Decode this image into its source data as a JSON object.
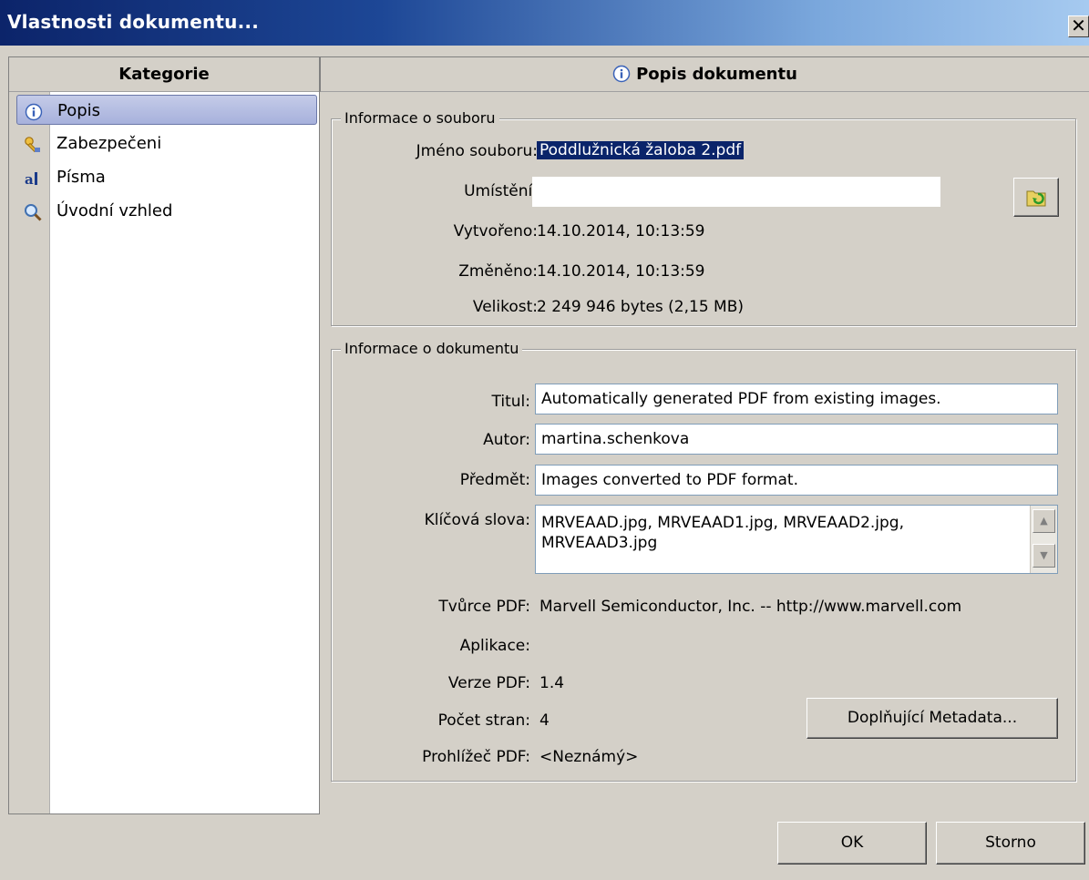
{
  "window": {
    "title": "Vlastnosti dokumentu...",
    "close_glyph": "✕"
  },
  "categories": {
    "header": "Kategorie",
    "items": [
      {
        "label": "Popis",
        "icon": "info-icon",
        "selected": true
      },
      {
        "label": "Zabezpečeni",
        "icon": "key-icon",
        "selected": false
      },
      {
        "label": "Písma",
        "icon": "font-icon",
        "selected": false
      },
      {
        "label": "Úvodní vzhled",
        "icon": "magnifier-icon",
        "selected": false
      }
    ]
  },
  "main": {
    "header": "Popis dokumentu",
    "file_info": {
      "title": "Informace o souboru",
      "filename_label": "Jméno souboru:",
      "filename_value": "Poddlužnická žaloba 2.pdf",
      "location_label": "Umístění:",
      "location_value": "",
      "created_label": "Vytvořeno:",
      "created_value": "14.10.2014, 10:13:59",
      "modified_label": "Změněno:",
      "modified_value": "14.10.2014, 10:13:59",
      "size_label": "Velikost:",
      "size_value": "2 249 946 bytes (2,15 MB)"
    },
    "doc_info": {
      "title": "Informace o dokumentu",
      "title_label": "Titul:",
      "title_value": "Automatically generated PDF from existing images.",
      "author_label": "Autor:",
      "author_value": "martina.schenkova",
      "subject_label": "Předmět:",
      "subject_value": "Images converted to PDF format.",
      "keywords_label": "Klíčová slova:",
      "keywords_line1": "MRVEAAD.jpg, MRVEAAD1.jpg, MRVEAAD2.jpg,",
      "keywords_line2": "MRVEAAD3.jpg",
      "creator_label": "Tvůrce PDF:",
      "creator_value": "Marvell Semiconductor, Inc.  -- http://www.marvell.com",
      "application_label": "Aplikace:",
      "application_value": "",
      "version_label": "Verze PDF:",
      "version_value": "1.4",
      "pages_label": "Počet stran:",
      "pages_value": "4",
      "viewer_label": "Prohlížeč PDF:",
      "viewer_value": "<Neznámý>",
      "metadata_button": "Doplňující Metadata..."
    }
  },
  "footer": {
    "ok_label": "OK",
    "cancel_label": "Storno"
  },
  "colors": {
    "titlebar_start": "#0c246a",
    "titlebar_end": "#a6caf0",
    "selection": "#0a246a",
    "dialog_bg": "#d4d0c8"
  }
}
